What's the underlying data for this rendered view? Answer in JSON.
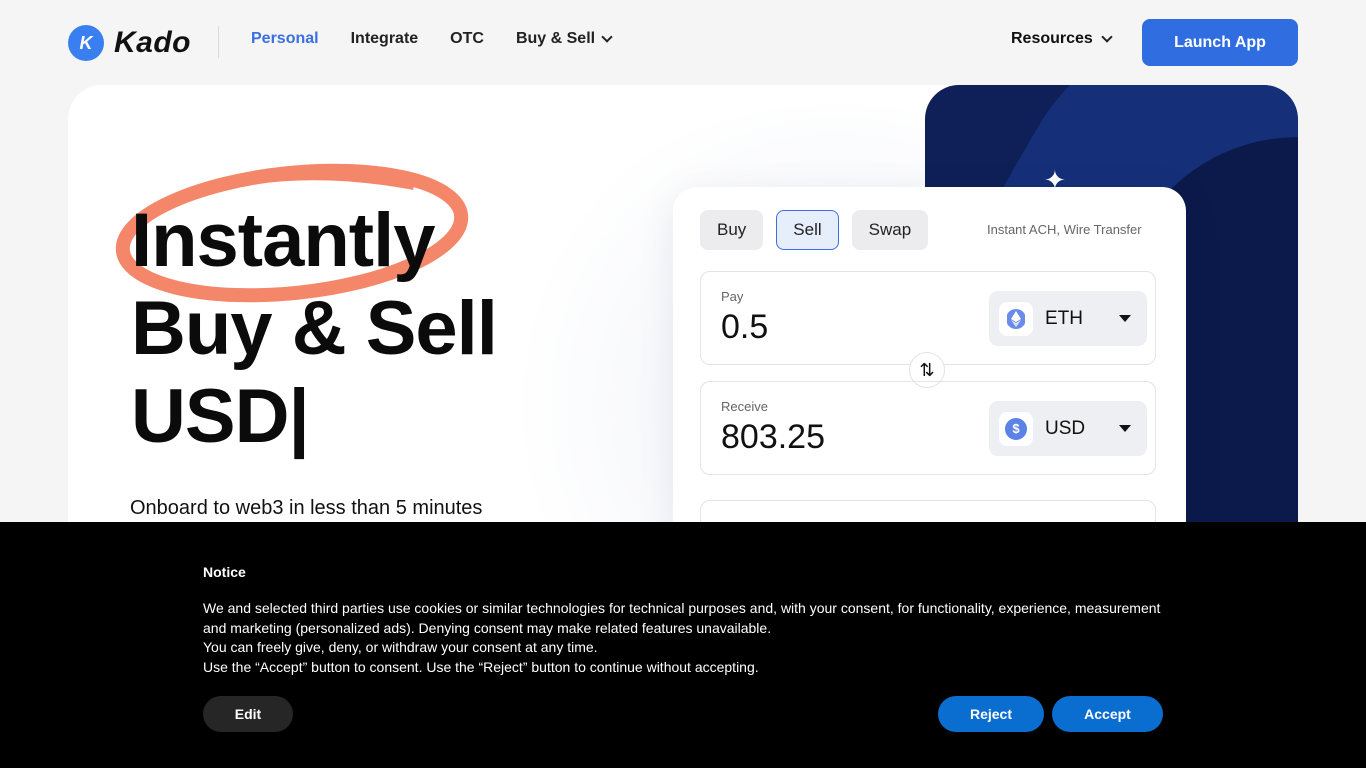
{
  "nav": {
    "logo_letter": "K",
    "logo_text": "Kado",
    "links": [
      "Personal",
      "Integrate",
      "OTC",
      "Buy & Sell"
    ],
    "resources": "Resources",
    "launch": "Launch App"
  },
  "hero": {
    "line1": "Instantly",
    "line2": "Buy & Sell",
    "line3": "USD|",
    "subtitle": "Onboard to web3 in less than 5 minutes"
  },
  "widget": {
    "tabs": [
      "Buy",
      "Sell",
      "Swap"
    ],
    "active_tab": "Sell",
    "method": "Instant ACH, Wire Transfer",
    "pay_label": "Pay",
    "pay_value": "0.5",
    "pay_asset": "ETH",
    "receive_label": "Receive",
    "receive_value": "803.25",
    "receive_asset": "USD"
  },
  "notice": {
    "title": "Notice",
    "line1": "We and selected third parties use cookies or similar technologies for technical purposes and, with your consent, for functionality, experience, measurement and marketing (personalized ads). Denying consent may make related features unavailable.",
    "line2": "You can freely give, deny, or withdraw your consent at any time.",
    "line3": "Use the “Accept” button to consent. Use the “Reject” button to continue without accepting.",
    "edit": "Edit",
    "reject": "Reject",
    "accept": "Accept"
  },
  "colors": {
    "accent": "#2f6de0",
    "panel": "#0e2057",
    "scribble": "#f4876a",
    "banner_button": "#0a6ed1"
  }
}
